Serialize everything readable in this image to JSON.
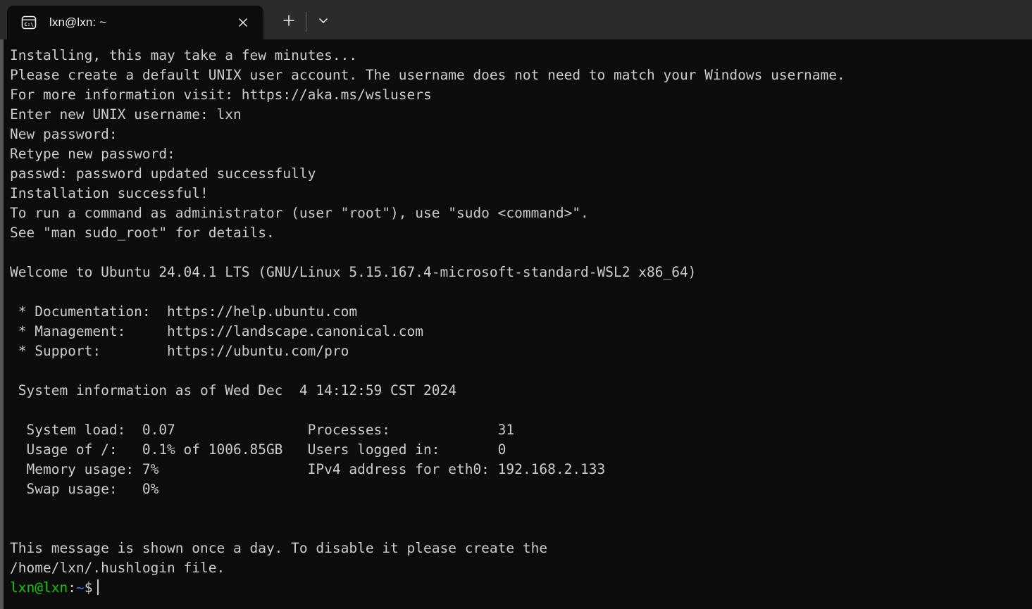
{
  "window": {
    "title": "lxn@lxn: ~",
    "background_color": "#0c0c0c",
    "titlebar_color": "#2b2b2b",
    "foreground_color": "#cccccc"
  },
  "tabbar": {
    "tab_label": "lxn@lxn: ~",
    "tab_icon": "command-prompt-icon",
    "close_icon": "close-icon",
    "newtab_icon": "plus-icon",
    "dropdown_icon": "chevron-down-icon"
  },
  "terminal": {
    "prompt": {
      "user_host": "lxn@lxn",
      "colon": ":",
      "path": "~",
      "sigil": "$",
      "user_host_color": "#16c60c",
      "path_color": "#3b78ff"
    },
    "lines": [
      "Installing, this may take a few minutes...",
      "Please create a default UNIX user account. The username does not need to match your Windows username.",
      "For more information visit: https://aka.ms/wslusers",
      "Enter new UNIX username: lxn",
      "New password:",
      "Retype new password:",
      "passwd: password updated successfully",
      "Installation successful!",
      "To run a command as administrator (user \"root\"), use \"sudo <command>\".",
      "See \"man sudo_root\" for details.",
      "",
      "Welcome to Ubuntu 24.04.1 LTS (GNU/Linux 5.15.167.4-microsoft-standard-WSL2 x86_64)",
      "",
      " * Documentation:  https://help.ubuntu.com",
      " * Management:     https://landscape.canonical.com",
      " * Support:        https://ubuntu.com/pro",
      "",
      " System information as of Wed Dec  4 14:12:59 CST 2024",
      "",
      "  System load:  0.07                Processes:             31",
      "  Usage of /:   0.1% of 1006.85GB   Users logged in:       0",
      "  Memory usage: 7%                  IPv4 address for eth0: 192.168.2.133",
      "  Swap usage:   0%",
      "",
      "",
      "This message is shown once a day. To disable it please create the",
      "/home/lxn/.hushlogin file."
    ],
    "motd": {
      "distro": "Ubuntu 24.04.1 LTS",
      "kernel": "GNU/Linux 5.15.167.4-microsoft-standard-WSL2 x86_64",
      "links": [
        {
          "label": "* Documentation:",
          "url": "https://help.ubuntu.com"
        },
        {
          "label": "* Management:",
          "url": "https://landscape.canonical.com"
        },
        {
          "label": "* Support:",
          "url": "https://ubuntu.com/pro"
        }
      ],
      "sysinfo_header": "System information as of Wed Dec  4 14:12:59 CST 2024",
      "stats": [
        {
          "label": "System load:",
          "value": "0.07",
          "label2": "Processes:",
          "value2": "31"
        },
        {
          "label": "Usage of /:",
          "value": "0.1% of 1006.85GB",
          "label2": "Users logged in:",
          "value2": "0"
        },
        {
          "label": "Memory usage:",
          "value": "7%",
          "label2": "IPv4 address for eth0:",
          "value2": "192.168.2.133"
        },
        {
          "label": "Swap usage:",
          "value": "0%",
          "label2": "",
          "value2": ""
        }
      ]
    }
  }
}
